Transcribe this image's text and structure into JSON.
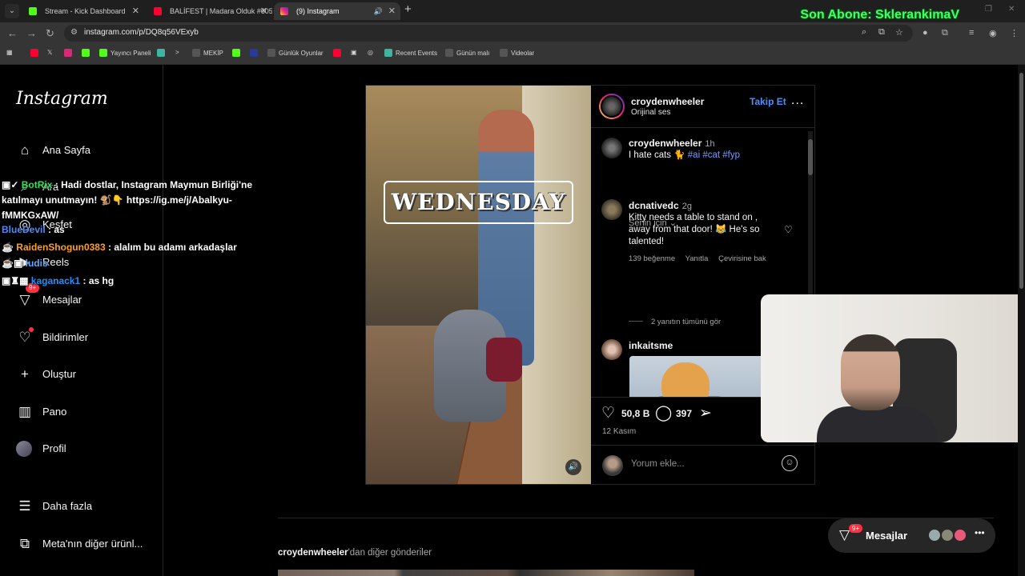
{
  "browser": {
    "tabs": [
      {
        "title": "Stream - Kick Dashboard"
      },
      {
        "title": "BALİFEST | Madara Olduk #605"
      },
      {
        "title": "(9) Instagram"
      }
    ],
    "url": "instagram.com/p/DQ8q56VExyb",
    "bookmarks": [
      "Yayıncı Paneli",
      "MEKİP",
      "Günlük Oyunlar",
      "Recent Events",
      "Günün malı",
      "Videolar"
    ],
    "overlay_text": "Son Abone: SklerankimaV"
  },
  "sidebar": {
    "logo": "Instagram",
    "items": [
      {
        "label": "Ana Sayfa"
      },
      {
        "label": "Ara"
      },
      {
        "label": "Keşfet"
      },
      {
        "label": "Reels"
      },
      {
        "label": "Mesajlar",
        "badge": "9+"
      },
      {
        "label": "Bildirimler"
      },
      {
        "label": "Oluştur"
      },
      {
        "label": "Pano"
      },
      {
        "label": "Profil"
      },
      {
        "label": "Daha fazla"
      },
      {
        "label": "Meta'nın diğer ürünl..."
      }
    ]
  },
  "chat": [
    {
      "user": "BotRix",
      "text": ": Hadi dostlar, Instagram Maymun Birliği'ne katılmayı unutmayın! 🐒👇 https://ig.me/j/Abalkyu-fMMKGxAW/"
    },
    {
      "user": "BlueDevil",
      "text": ": as"
    },
    {
      "user": "RaidenShogun0383",
      "text": ": alalım bu adamı arkadaşlar"
    },
    {
      "user": "ludis",
      "text": ""
    },
    {
      "user": "kaganack1",
      "text": ": as hg"
    }
  ],
  "post": {
    "video_overlay": "WEDNESDAY",
    "author": "croydenwheeler",
    "audio": "Orijinal ses",
    "follow": "Takip Et",
    "more": "...",
    "caption": {
      "user": "croydenwheeler",
      "time": "1h",
      "text": "I hate cats 🐈",
      "tags": "#ai #cat #fyp"
    },
    "sort_label": "Senin için",
    "comments": [
      {
        "user": "dcnativedc",
        "time": "2g",
        "text": "Kitty needs a table to stand on , away from that door! 😹 He's so talented!",
        "likes": "139 beğenme",
        "reply": "Yanıtla",
        "translate": "Çevirisine bak",
        "replies": "2 yanıtın tümünü gör"
      },
      {
        "user": "inkaitsme"
      }
    ],
    "like_count": "50,8 B",
    "comment_count": "397",
    "date": "12 Kasım",
    "comment_placeholder": "Yorum ekle..."
  },
  "more_posts": {
    "user": "croydenwheeler",
    "text": "'dan diğer gönderiler"
  },
  "messages_pill": {
    "label": "Mesajlar",
    "badge": "9+"
  },
  "colors": {
    "accent": "#4a90ff",
    "badge": "#ff3040",
    "overlay_green": "#3cff6a"
  }
}
